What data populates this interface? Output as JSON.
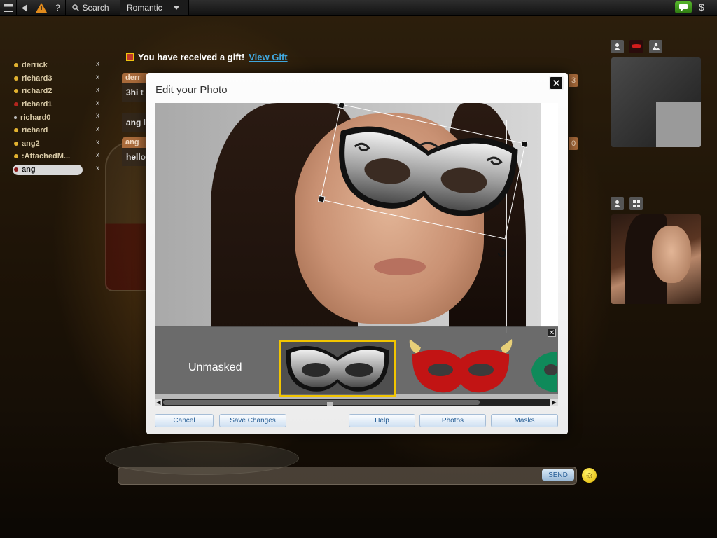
{
  "topbar": {
    "search_label": "Search",
    "room_label": "Romantic",
    "icons": [
      "window-icon",
      "back-icon",
      "warning-icon",
      "help-icon",
      "search-icon",
      "dropdown-icon",
      "chat-icon",
      "dollar-icon"
    ],
    "help_glyph": "?",
    "dollar_glyph": "$"
  },
  "users": [
    {
      "name": "derrick",
      "dot": "#e2b230"
    },
    {
      "name": "richard3",
      "dot": "#e2b230"
    },
    {
      "name": "richard2",
      "dot": "#e2b230"
    },
    {
      "name": "richard1",
      "dot": "#b3261e"
    },
    {
      "name": "richard0",
      "dot": "#bdbdbd"
    },
    {
      "name": "richard",
      "dot": "#e2b230"
    },
    {
      "name": "ang2",
      "dot": "#e2b230"
    },
    {
      "name": ":AttachedM...",
      "dot": "#e2b230"
    },
    {
      "name": "ang",
      "dot": "#8b1a1a",
      "selected": true
    }
  ],
  "user_close_glyph": "x",
  "gift": {
    "text": "You have received a gift!",
    "link": "View Gift"
  },
  "chat": {
    "messages": [
      {
        "head": "derr",
        "body": "3hi t",
        "badge": "3"
      },
      {
        "head": "",
        "body": "ang l"
      },
      {
        "head": "ang",
        "body": "hello",
        "badge": "0"
      }
    ]
  },
  "right_panel": {
    "tile1_icons": [
      "user-icon",
      "mask-icon",
      "photo-icon"
    ],
    "tile2_icons": [
      "user-icon",
      "grid-icon"
    ]
  },
  "composer": {
    "send_label": "SEND",
    "smiley_glyph": "☺"
  },
  "dialog": {
    "title": "Edit your Photo",
    "close_glyph": "✕",
    "strip_close_glyph": "✕",
    "unmasked_label": "Unmasked",
    "masks": [
      {
        "name": "silver-masquerade",
        "selected": true
      },
      {
        "name": "red-devil",
        "selected": false
      },
      {
        "name": "green",
        "selected": false
      }
    ],
    "buttons": {
      "cancel": "Cancel",
      "save": "Save Changes",
      "help": "Help",
      "photos": "Photos",
      "masks": "Masks"
    }
  },
  "colors": {
    "accent_blue": "#41a9e0",
    "selection_yellow": "#f2c500",
    "button_text": "#235b93"
  }
}
